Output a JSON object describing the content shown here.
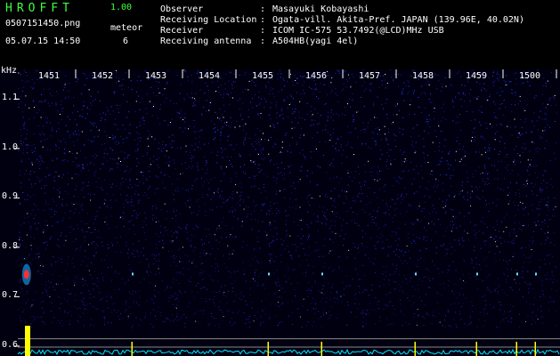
{
  "app": {
    "name": "HROFFT",
    "version": "1.00"
  },
  "file": {
    "name": "0507151450.png",
    "datetime": "05.07.15 14:50"
  },
  "meteor": {
    "label": "meteor",
    "count": "6"
  },
  "station": [
    {
      "key": "Observer",
      "value": "Masayuki Kobayashi"
    },
    {
      "key": "Receiving Location",
      "value": "Ogata-vill. Akita-Pref. JAPAN (139.96E, 40.02N)"
    },
    {
      "key": "Receiver",
      "value": "ICOM IC-575 53.7492(@LCD)MHz USB"
    },
    {
      "key": "Receiving antenna",
      "value": "A504HB(yagi 4el)"
    }
  ],
  "colors": {
    "title": "#3cff3c",
    "noise": "#1a2cff",
    "echo": "#ffff00",
    "baseline": "#00e5ff",
    "hot": "#ff3030"
  },
  "chart_data": {
    "type": "heatmap",
    "ylabel": "kHz",
    "x_ticks": [
      "1451",
      "1452",
      "1453",
      "1454",
      "1455",
      "1456",
      "1457",
      "1458",
      "1459",
      "1500"
    ],
    "y_ticks": [
      "1.1",
      "1.0",
      "0.9",
      "0.8",
      "0.7",
      "0.6"
    ],
    "ylim": [
      0.58,
      1.16
    ],
    "xlim_minutes": [
      0,
      10
    ],
    "echo_markers_minutes": [
      0.1,
      2.05,
      4.6,
      5.6,
      7.35,
      8.5,
      9.25,
      9.6
    ],
    "meteor_head": {
      "minute": 0.08,
      "khz": 0.745
    },
    "reference_lines_khz": [
      0.615,
      0.598
    ]
  }
}
